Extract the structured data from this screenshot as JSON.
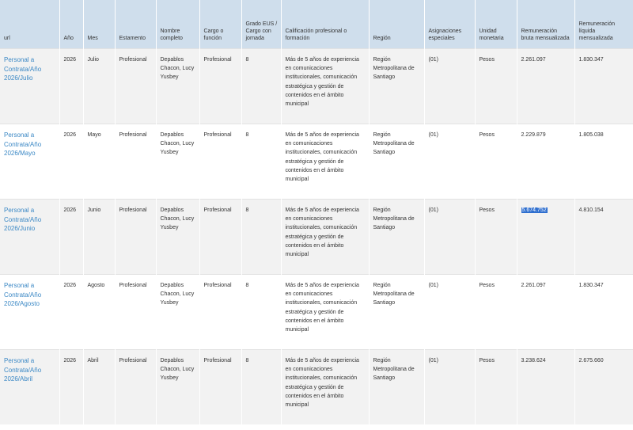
{
  "headers": [
    "url",
    "Año",
    "Mes",
    "Estamento",
    "Nombre completo",
    "Cargo o función",
    "Grado EUS / Cargo con jornada",
    "Calificación profesional o formación",
    "Región",
    "Asignaciones especiales",
    "Unidad monetaria",
    "Remuneración bruta mensualizada",
    "Remuneración líquida mensualizada"
  ],
  "rows": [
    {
      "url": "Personal a Contrata/Año 2026/Julio",
      "anio": "2026",
      "mes": "Julio",
      "estamento": "Profesional",
      "nombre": "Depablos Chacon, Lucy Yusbey",
      "cargo": "Profesional",
      "grado": "8",
      "calificacion": "Más de 5 años de experiencia en comunicaciones institucionales, comunicación estratégica y gestión de contenidos en el ámbito municipal",
      "region": "Región Metropolitana de Santiago",
      "asignaciones": "(01)",
      "unidad": "Pesos",
      "bruta": "2.261.097",
      "liquida": "1.830.347"
    },
    {
      "url": "Personal a Contrata/Año 2026/Mayo",
      "anio": "2026",
      "mes": "Mayo",
      "estamento": "Profesional",
      "nombre": "Depablos Chacon, Lucy Yusbey",
      "cargo": "Profesional",
      "grado": "8",
      "calificacion": "Más de 5 años de experiencia en comunicaciones institucionales, comunicación estratégica y gestión de contenidos en el ámbito municipal",
      "region": "Región Metropolitana de Santiago",
      "asignaciones": "(01)",
      "unidad": "Pesos",
      "bruta": "2.229.879",
      "liquida": "1.805.038"
    },
    {
      "url": "Personal a Contrata/Año 2026/Junio",
      "anio": "2026",
      "mes": "Junio",
      "estamento": "Profesional",
      "nombre": "Depablos Chacon, Lucy Yusbey",
      "cargo": "Profesional",
      "grado": "8",
      "calificacion": "Más de 5 años de experiencia en comunicaciones institucionales, comunicación estratégica y gestión de contenidos en el ámbito municipal",
      "region": "Región Metropolitana de Santiago",
      "asignaciones": "(01)",
      "unidad": "Pesos",
      "bruta": "5.674.752",
      "liquida": "4.810.154",
      "bruta_selected": true
    },
    {
      "url": "Personal a Contrata/Año 2026/Agosto",
      "anio": "2026",
      "mes": "Agosto",
      "estamento": "Profesional",
      "nombre": "Depablos Chacon, Lucy Yusbey",
      "cargo": "Profesional",
      "grado": "8",
      "calificacion": "Más de 5 años de experiencia en comunicaciones institucionales, comunicación estratégica y gestión de contenidos en el ámbito municipal",
      "region": "Región Metropolitana de Santiago",
      "asignaciones": "(01)",
      "unidad": "Pesos",
      "bruta": "2.261.097",
      "liquida": "1.830.347"
    },
    {
      "url": "Personal a Contrata/Año 2026/Abril",
      "anio": "2026",
      "mes": "Abril",
      "estamento": "Profesional",
      "nombre": "Depablos Chacon, Lucy Yusbey",
      "cargo": "Profesional",
      "grado": "8",
      "calificacion": "Más de 5 años de experiencia en comunicaciones institucionales, comunicación estratégica y gestión de contenidos en el ámbito municipal",
      "region": "Región Metropolitana de Santiago",
      "asignaciones": "(01)",
      "unidad": "Pesos",
      "bruta": "3.238.624",
      "liquida": "2.675.660"
    }
  ],
  "colors": {
    "header_bg": "#cfdeec",
    "link": "#3b88c5",
    "row_alt": "#f2f2f2",
    "selection": "#2f6fcf"
  }
}
